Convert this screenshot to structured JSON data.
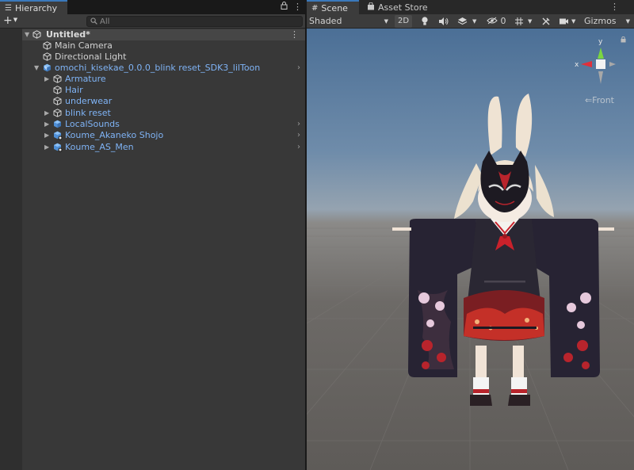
{
  "hierarchy": {
    "tab_label": "Hierarchy",
    "add_label": "+",
    "search_placeholder": "All",
    "scene_name": "Untitled*",
    "items": [
      {
        "label": "Main Camera"
      },
      {
        "label": "Directional Light"
      },
      {
        "label": "omochi_kisekae_0.0.0_blink reset_SDK3_lilToon"
      },
      {
        "label": "Armature"
      },
      {
        "label": "Hair"
      },
      {
        "label": "underwear"
      },
      {
        "label": "blink reset"
      },
      {
        "label": "LocalSounds"
      },
      {
        "label": "Koume_Akaneko Shojo"
      },
      {
        "label": "Koume_AS_Men"
      }
    ]
  },
  "scene_view": {
    "tabs": [
      {
        "label": "Scene"
      },
      {
        "label": "Asset Store"
      }
    ],
    "shading_mode": "Shaded",
    "toggle_2d": "2D",
    "hidden_count": "0",
    "gizmos_label": "Gizmos",
    "gizmo": {
      "axis_y": "y",
      "axis_x": "x",
      "view_label": "Front"
    }
  },
  "colors": {
    "prefab_blue": "#7fb3f5",
    "accent": "#3a79bb",
    "axis_x": "#e0303a",
    "axis_y": "#7bd640"
  }
}
